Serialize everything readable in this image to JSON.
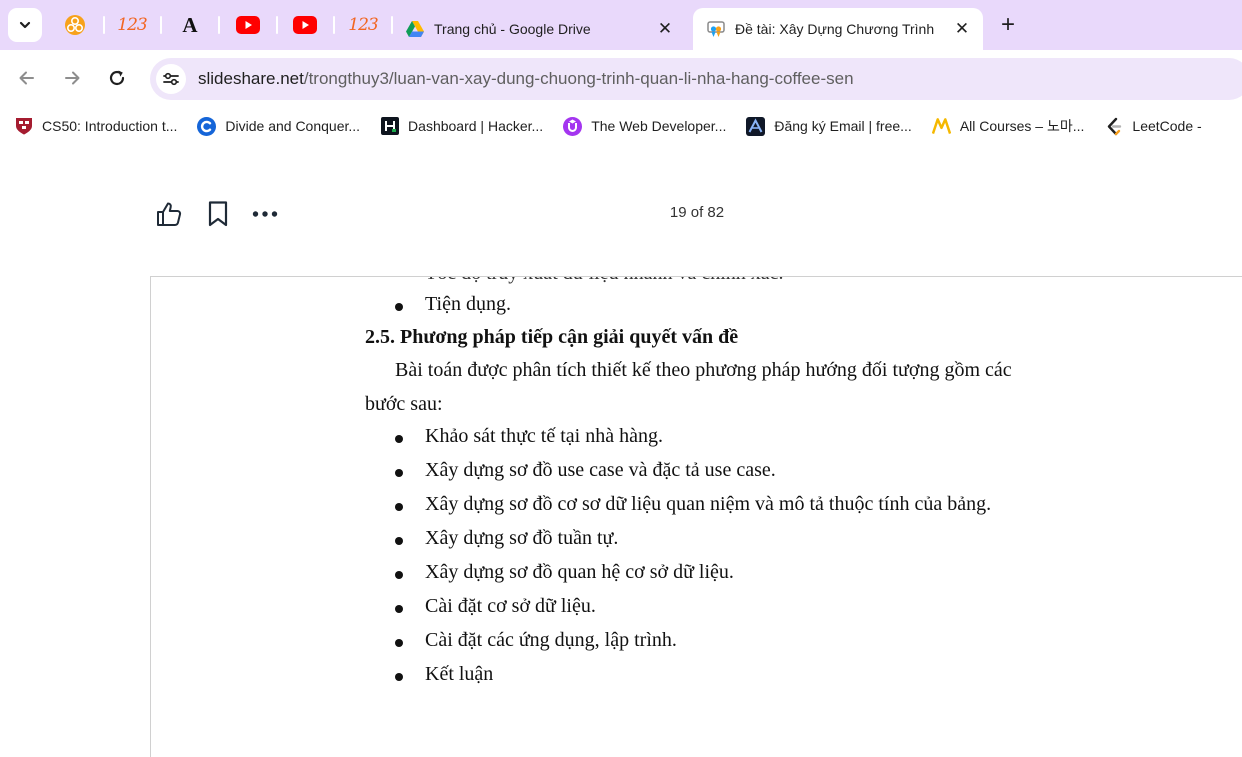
{
  "browser": {
    "tabs": [
      {
        "title": "Trang chủ - Google Drive",
        "close": "✕"
      },
      {
        "title": "Đề tài: Xây Dựng Chương Trình",
        "close": "✕"
      }
    ],
    "pinned_labels": {
      "p123a": "123",
      "p123b": "123",
      "font_a": "A"
    },
    "new_tab": "+",
    "url_host": "slideshare.net",
    "url_path": "/trongthuy3/luan-van-xay-dung-chuong-trinh-quan-li-nha-hang-coffee-sen",
    "bookmarks": [
      {
        "label": "CS50: Introduction t..."
      },
      {
        "label": "Divide and Conquer..."
      },
      {
        "label": "Dashboard | Hacker..."
      },
      {
        "label": "The Web Developer..."
      },
      {
        "label": "Đăng ký Email | free..."
      },
      {
        "label": "All Courses – 노마..."
      },
      {
        "label": "LeetCode -"
      }
    ]
  },
  "viewer": {
    "page_count": "19 of 82"
  },
  "document": {
    "cut_line": "Tốc độ truy xuất dữ liệu nhanh và chính xác.",
    "first_bullet": "Tiện dụng.",
    "heading": "2.5. Phương pháp tiếp cận giải quyết vấn đề",
    "para_line1": "Bài toán được phân tích thiết kế theo phương pháp hướng đối tượng gồm các",
    "para_line2": "bước sau:",
    "steps": [
      "Khảo sát thực tế tại nhà hàng.",
      "Xây dựng sơ đồ use case và đặc tả use case.",
      "Xây dựng sơ đồ cơ sơ dữ liệu quan niệm và mô tả thuộc tính của bảng.",
      "Xây dựng sơ đồ tuần tự.",
      "Xây dựng sơ đồ quan hệ cơ sở dữ liệu.",
      "Cài đặt cơ sở dữ liệu.",
      "Cài đặt các ứng dụng, lập trình.",
      "Kết luận"
    ]
  },
  "colors": {
    "tabstrip_bg": "#e9d9fb",
    "omnibox_bg": "#efe6fa",
    "youtube_red": "#ff0000",
    "numbers_orange": "#f26522"
  }
}
